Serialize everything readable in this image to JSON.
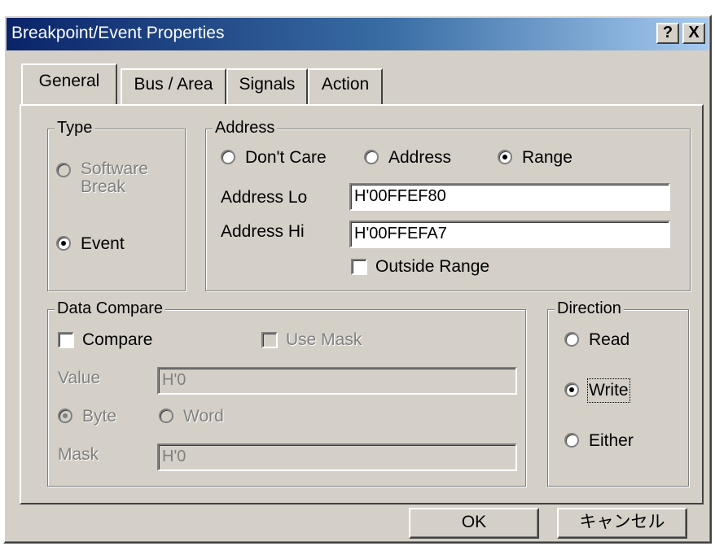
{
  "window": {
    "title": "Breakpoint/Event Properties",
    "help_label": "?",
    "close_label": "X"
  },
  "tabs": [
    {
      "label": "General",
      "active": true
    },
    {
      "label": "Bus / Area",
      "active": false
    },
    {
      "label": "Signals",
      "active": false
    },
    {
      "label": "Action",
      "active": false
    }
  ],
  "type_group": {
    "legend": "Type",
    "software_break_line1": "Software",
    "software_break_line2": "Break",
    "event_label": "Event",
    "selected": "Event"
  },
  "address_group": {
    "legend": "Address",
    "options": [
      "Don't Care",
      "Address",
      "Range"
    ],
    "selected": "Range",
    "address_lo_label": "Address Lo",
    "address_lo_value": "H'00FFEF80",
    "address_hi_label": "Address Hi",
    "address_hi_value": "H'00FFEFA7",
    "outside_range_label": "Outside Range",
    "outside_range_checked": false
  },
  "data_compare_group": {
    "legend": "Data Compare",
    "compare_label": "Compare",
    "compare_checked": false,
    "use_mask_label": "Use Mask",
    "use_mask_checked": false,
    "value_label": "Value",
    "value_value": "H'0",
    "byte_label": "Byte",
    "word_label": "Word",
    "size_selected": "Byte",
    "mask_label": "Mask",
    "mask_value": "H'0"
  },
  "direction_group": {
    "legend": "Direction",
    "options": [
      "Read",
      "Write",
      "Either"
    ],
    "selected": "Write"
  },
  "buttons": {
    "ok_label": "OK",
    "cancel_label": "キャンセル"
  }
}
